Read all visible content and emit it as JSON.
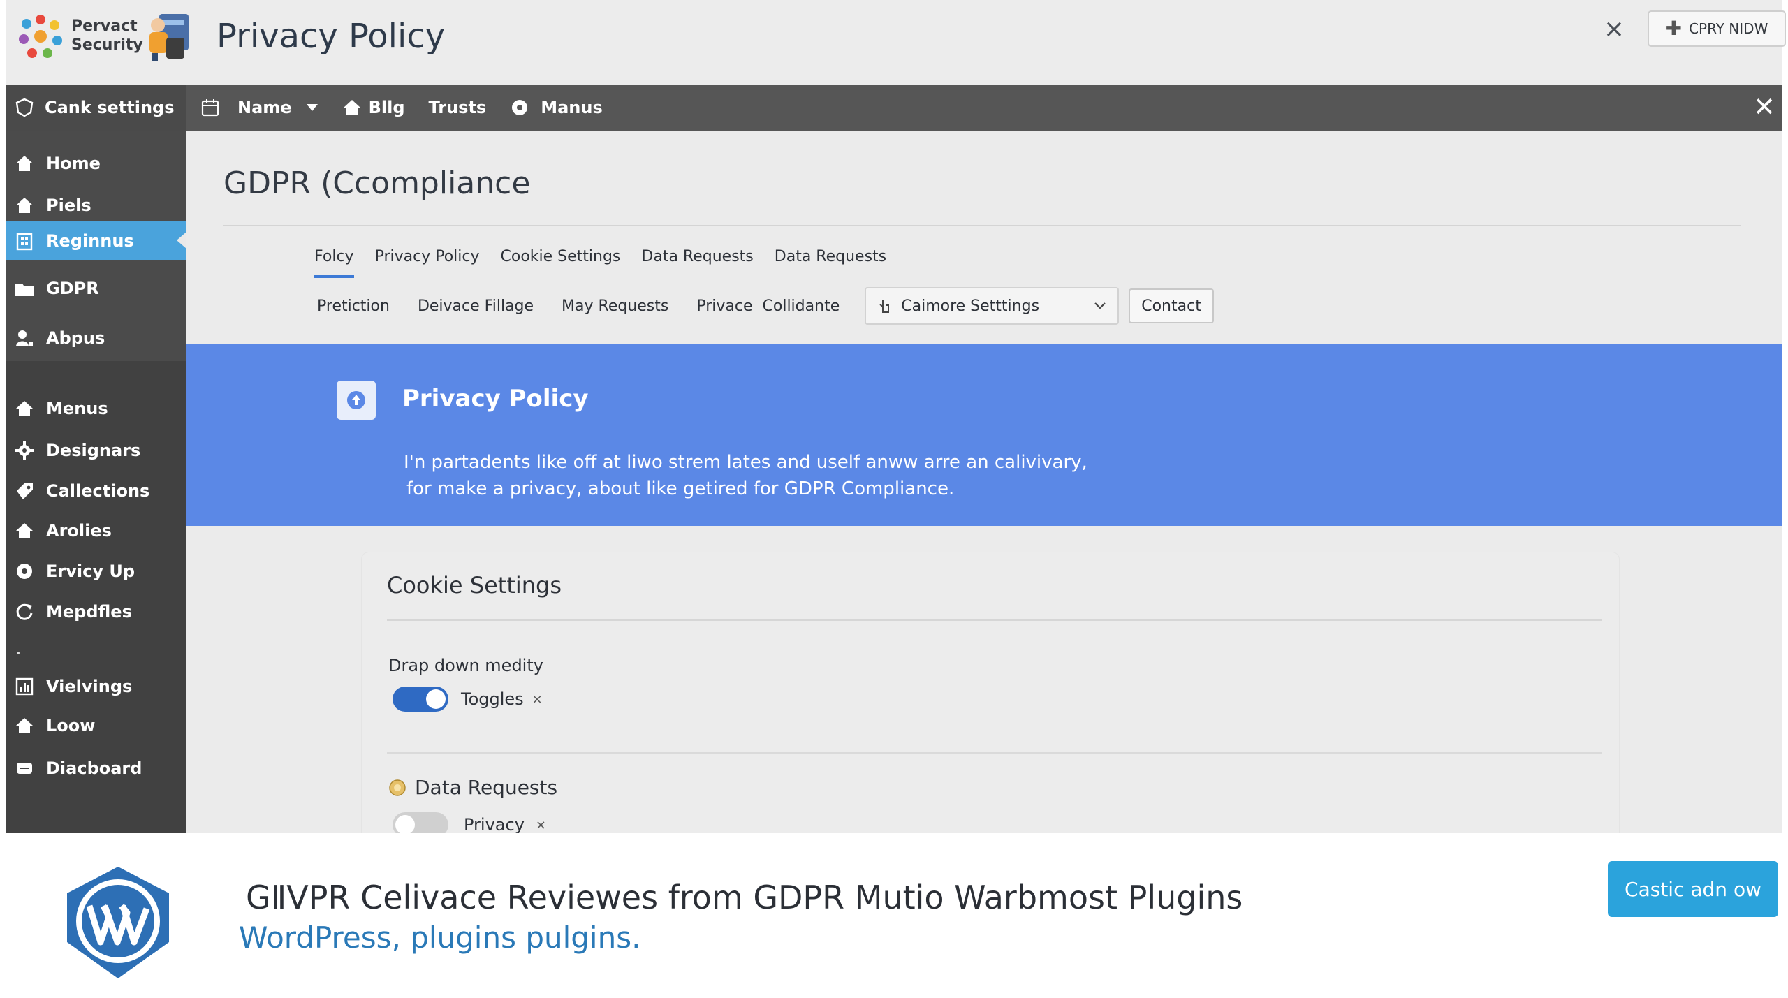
{
  "header": {
    "brand_line1": "Pervact",
    "brand_line2": "Security",
    "page_title": "Privacy Policy",
    "cta_label": "CPRY NIDW"
  },
  "navbar": {
    "left_label": "Cank settings",
    "items": [
      {
        "label": "Name",
        "icon": "calendar-icon"
      },
      {
        "label": "Bllg",
        "icon": "home-icon"
      },
      {
        "label": "Trusts",
        "icon": ""
      },
      {
        "label": "Manus",
        "icon": "gear-icon"
      }
    ]
  },
  "sidebar": {
    "items": [
      {
        "label": "Home",
        "icon": "home-icon"
      },
      {
        "label": "Piels",
        "icon": "home-icon"
      },
      {
        "label": "Reginnus",
        "icon": "building-icon",
        "active": true
      },
      {
        "label": "GDPR",
        "icon": "folder-icon"
      },
      {
        "label": "Abpus",
        "icon": "user-icon"
      },
      {
        "label": "Menus",
        "icon": "home-icon"
      },
      {
        "label": "Designars",
        "icon": "gear-icon"
      },
      {
        "label": "Callections",
        "icon": "tag-icon"
      },
      {
        "label": "Arolies",
        "icon": "home-icon"
      },
      {
        "label": "Ervicy Up",
        "icon": "gear-icon"
      },
      {
        "label": "Mepdfles",
        "icon": "refresh-icon"
      },
      {
        "label": "Vielvings",
        "icon": "chart-icon"
      },
      {
        "label": "Loow",
        "icon": "home-icon"
      },
      {
        "label": "Diacboard",
        "icon": "drive-icon"
      }
    ]
  },
  "main": {
    "heading": "GDPR (Ccompliance",
    "tabs": [
      {
        "label": "Folcy",
        "active": true
      },
      {
        "label": "Privacy Policy"
      },
      {
        "label": "Cookie Settings"
      },
      {
        "label": "Data Requests"
      },
      {
        "label": "Data Requests"
      }
    ],
    "subnav": [
      "Pretiction",
      "Deivace Fillage",
      "May Requests",
      "Privace  Collidante"
    ],
    "select_value": "Caimore Setttings",
    "contact_label": "Contact",
    "hero": {
      "title": "Privacy Policy",
      "line1": "I'n partadents like off at liwo strem lates and uself anww arre an calivivary,",
      "line2": "for make a privacy, about like getired for GDPR Compliance."
    },
    "card": {
      "title": "Cookie Settings",
      "dropdown_label": "Drap down medity",
      "toggle1_label": "Toggles",
      "toggle1_on": true,
      "section2_title": "Data Requests",
      "toggle2_label": "Privacy",
      "toggle2_on": false,
      "x_mark": "×"
    }
  },
  "banner": {
    "title": "GⅡVPR Celivace Reviewes from GDPR Mutio Warbmost Plugins",
    "subtitle": "WordPress, plugins pulgins.",
    "button_label": "Castic adn ow"
  },
  "colors": {
    "accent_blue": "#5b88e6",
    "active_sidebar": "#4aa3dc",
    "banner_button": "#2ba3dc",
    "link_blue": "#2a79b7"
  }
}
